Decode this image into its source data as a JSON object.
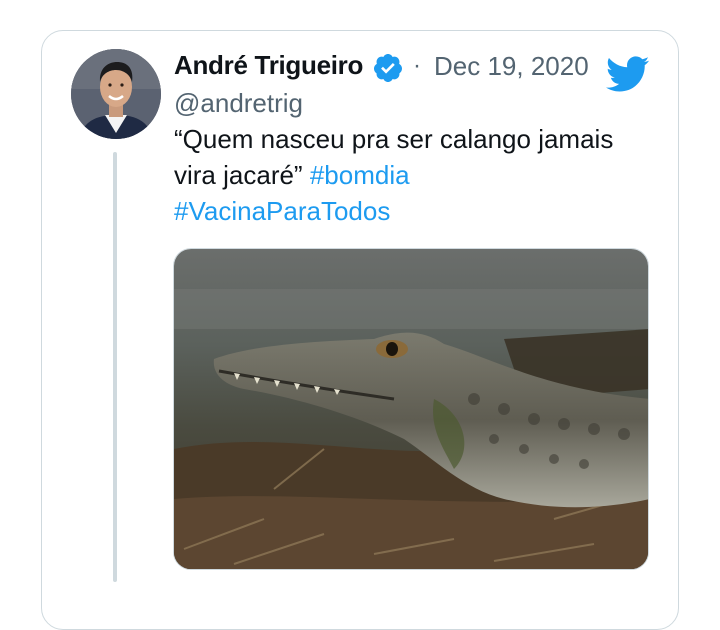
{
  "author": {
    "name": "André Trigueiro",
    "handle": "@andretrig",
    "verified": true
  },
  "tweet": {
    "separator": "·",
    "date": "Dec 19, 2020",
    "text_line1": "“Quem nasceu pra ser calango jamais",
    "text_line2": "vira jacaré”",
    "hashtag1": "#bomdia",
    "hashtag2": "#VacinaParaTodos"
  },
  "icons": {
    "verified": "verified-badge-icon",
    "brand": "twitter-bird-icon"
  },
  "colors": {
    "accent": "#1d9bf0",
    "text": "#0f1419",
    "muted": "#536471",
    "border": "#cfd9de"
  }
}
